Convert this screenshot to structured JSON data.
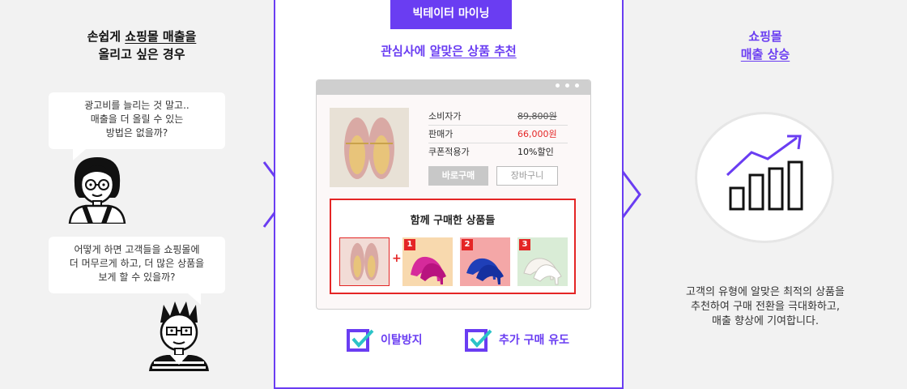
{
  "left": {
    "title_line1_plain": "손쉽게 ",
    "title_line1_underline": "쇼핑몰 매출을",
    "title_line2": "올리고 싶은 경우",
    "bubble1": [
      "광고비를 늘리는 것 말고..",
      "매출을 더 올릴 수 있는",
      "방법은 없을까?"
    ],
    "bubble2": [
      "어떻게 하면 고객들을 쇼핑몰에",
      "더 머무르게 하고, 더 많은 상품을",
      "보게 할 수 있을까?"
    ]
  },
  "panel": {
    "badge": "빅테이터 마이닝",
    "subtitle_plain": "관심사에 ",
    "subtitle_underline": "알맞은 상품 추천",
    "price_rows": [
      {
        "label": "소비자가",
        "value": "89,800원"
      },
      {
        "label": "판매가",
        "value": "66,000원"
      },
      {
        "label": "쿠폰적용가",
        "value": "10%할인"
      }
    ],
    "buy_button": "바로구매",
    "cart_button": "장바구니",
    "together_title": "함께  구매한 상품들",
    "ranks": [
      "1",
      "2",
      "3"
    ],
    "plus": "+",
    "check1": "이탈방지",
    "check2": "추가 구매 유도"
  },
  "right": {
    "title_line1": "쇼핑몰",
    "title_line2": "매출 상승",
    "desc": [
      "고객의 유형에 알맞은 최적의 상품을",
      "추천하여 구매 전환을 극대화하고,",
      "매출 향상에 기여합니다."
    ]
  },
  "colors": {
    "accent": "#6a3df2",
    "check": "#2bc3c8",
    "highlight": "#e42525"
  }
}
